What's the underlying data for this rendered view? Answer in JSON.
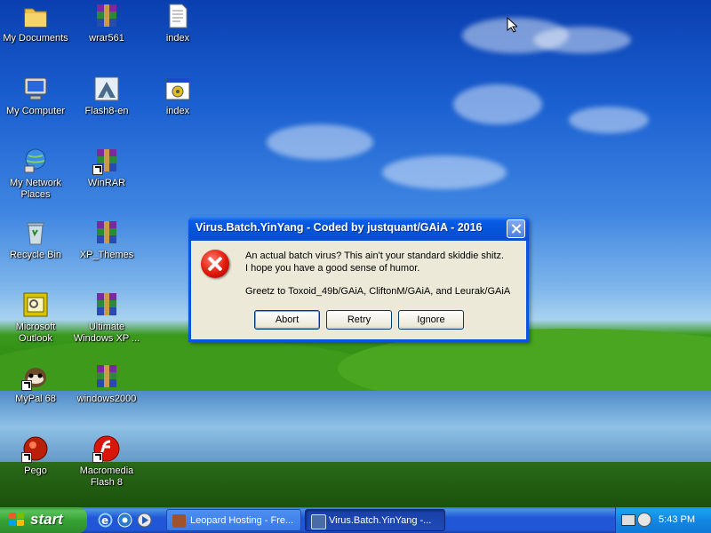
{
  "desktop": {
    "icons": [
      {
        "label": "My Documents",
        "icon": "folder-icon"
      },
      {
        "label": "wrar561",
        "icon": "winrar-archive-icon"
      },
      {
        "label": "index",
        "icon": "text-document-icon"
      },
      {
        "label": "My Computer",
        "icon": "computer-icon"
      },
      {
        "label": "Flash8-en",
        "icon": "installer-icon"
      },
      {
        "label": "index",
        "icon": "batch-file-icon"
      },
      {
        "label": "My Network Places",
        "icon": "network-icon"
      },
      {
        "label": "WinRAR",
        "icon": "winrar-shortcut-icon"
      },
      {
        "label": "Recycle Bin",
        "icon": "recycle-bin-icon"
      },
      {
        "label": "XP_Themes",
        "icon": "winrar-archive-icon"
      },
      {
        "label": "Microsoft Outlook",
        "icon": "outlook-icon"
      },
      {
        "label": "Ultimate Windows XP ...",
        "icon": "winrar-archive-icon"
      },
      {
        "label": "MyPal 68",
        "icon": "mypal-browser-icon"
      },
      {
        "label": "windows2000",
        "icon": "winrar-archive-icon"
      },
      {
        "label": "Pego",
        "icon": "pego-icon"
      },
      {
        "label": "Macromedia Flash 8",
        "icon": "flash-icon"
      }
    ]
  },
  "dialog": {
    "title": "Virus.Batch.YinYang - Coded by justquant/GAiA - 2016",
    "line1": "An actual batch virus? This ain't your standard skiddie shitz.",
    "line2": "I hope you have a good sense of humor.",
    "line3": "Greetz to Toxoid_49b/GAiA, CliftonM/GAiA, and Leurak/GAiA",
    "buttons": {
      "abort": "Abort",
      "retry": "Retry",
      "ignore": "Ignore"
    }
  },
  "taskbar": {
    "start_label": "start",
    "tasks": [
      {
        "label": "Leopard Hosting - Fre...",
        "active": false
      },
      {
        "label": "Virus.Batch.YinYang -...",
        "active": true
      }
    ],
    "clock": "5:43 PM"
  },
  "colors": {
    "titlebar": "#0a5ce6",
    "dialog_bg": "#ece9d8",
    "taskbar": "#2157d7",
    "start_button": "#37a234",
    "tray": "#1387e3"
  }
}
